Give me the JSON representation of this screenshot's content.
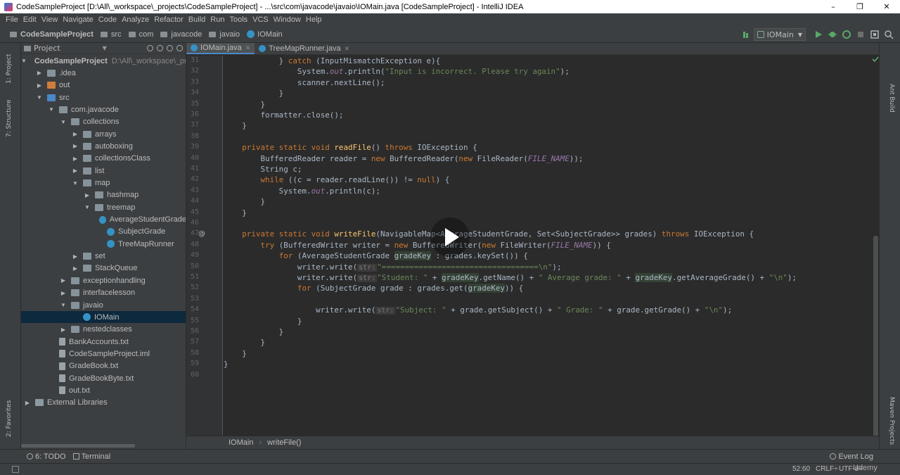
{
  "window": {
    "title": "CodeSampleProject [D:\\All\\_workspace\\_projects\\CodeSampleProject] - ...\\src\\com\\javacode\\javaio\\IOMain.java [CodeSampleProject] - IntelliJ IDEA",
    "controls": [
      "–",
      "❐",
      "✕"
    ]
  },
  "menu": [
    "File",
    "Edit",
    "View",
    "Navigate",
    "Code",
    "Analyze",
    "Refactor",
    "Build",
    "Run",
    "Tools",
    "VCS",
    "Window",
    "Help"
  ],
  "nav": {
    "crumbs": [
      "CodeSampleProject",
      "src",
      "com",
      "javacode",
      "javaio",
      "IOMain"
    ],
    "run_config": "IOMain"
  },
  "left_tabs": {
    "project": "1: Project",
    "structure": "7: Structure",
    "favorites": "2: Favorites"
  },
  "right_tabs": {
    "ant": "Ant Build",
    "maven": "Maven Projects"
  },
  "project_panel": {
    "header": "Project",
    "tree": [
      {
        "label": "CodeSampleProject",
        "hint": "D:\\All\\_workspace\\_proje",
        "arrow": "▼",
        "icon": "folder",
        "bold": true
      },
      {
        "label": ".idea",
        "arrow": "▶",
        "icon": "folder"
      },
      {
        "label": "out",
        "arrow": "▶",
        "icon": "out"
      },
      {
        "label": "src",
        "arrow": "▼",
        "icon": "src"
      },
      {
        "label": "com.javacode",
        "arrow": "▼",
        "icon": "folder"
      },
      {
        "label": "collections",
        "arrow": "▼",
        "icon": "folder"
      },
      {
        "label": "arrays",
        "arrow": "▶",
        "icon": "folder"
      },
      {
        "label": "autoboxing",
        "arrow": "▶",
        "icon": "folder"
      },
      {
        "label": "collectionsClass",
        "arrow": "▶",
        "icon": "folder"
      },
      {
        "label": "list",
        "arrow": "▶",
        "icon": "folder"
      },
      {
        "label": "map",
        "arrow": "▼",
        "icon": "folder"
      },
      {
        "label": "hashmap",
        "arrow": "▶",
        "icon": "folder"
      },
      {
        "label": "treemap",
        "arrow": "▼",
        "icon": "folder"
      },
      {
        "label": "AverageStudentGrade",
        "arrow": "",
        "icon": "class"
      },
      {
        "label": "SubjectGrade",
        "arrow": "",
        "icon": "class"
      },
      {
        "label": "TreeMapRunner",
        "arrow": "",
        "icon": "class"
      },
      {
        "label": "set",
        "arrow": "▶",
        "icon": "folder"
      },
      {
        "label": "StackQueue",
        "arrow": "▶",
        "icon": "folder"
      },
      {
        "label": "exceptionhandling",
        "arrow": "▶",
        "icon": "folder"
      },
      {
        "label": "interfacelesson",
        "arrow": "▶",
        "icon": "folder"
      },
      {
        "label": "javaio",
        "arrow": "▼",
        "icon": "folder"
      },
      {
        "label": "IOMain",
        "arrow": "",
        "icon": "class",
        "selected": true
      },
      {
        "label": "nestedclasses",
        "arrow": "▶",
        "icon": "folder"
      },
      {
        "label": "BankAccounts.txt",
        "arrow": "",
        "icon": "file"
      },
      {
        "label": "CodeSampleProject.iml",
        "arrow": "",
        "icon": "file"
      },
      {
        "label": "GradeBook.txt",
        "arrow": "",
        "icon": "file"
      },
      {
        "label": "GradeBookByte.txt",
        "arrow": "",
        "icon": "file"
      },
      {
        "label": "out.txt",
        "arrow": "",
        "icon": "file"
      },
      {
        "label": "External Libraries",
        "arrow": "▶",
        "icon": "library"
      }
    ]
  },
  "tabs": [
    {
      "label": "IOMain.java",
      "active": true
    },
    {
      "label": "TreeMapRunner.java",
      "active": false
    }
  ],
  "code": {
    "lines": [
      {
        "n": "31",
        "segs": [
          [
            "            } ",
            ""
          ],
          [
            "catch ",
            "kw"
          ],
          [
            "(InputMismatchException e){",
            ""
          ]
        ]
      },
      {
        "n": "32",
        "segs": [
          [
            "                System.",
            ""
          ],
          [
            "out",
            "cn"
          ],
          [
            ".println(",
            ""
          ],
          [
            "\"Input is incorrect. Please try again\"",
            "st"
          ],
          [
            ");",
            ""
          ]
        ]
      },
      {
        "n": "33",
        "segs": [
          [
            "                scanner.nextLine();",
            ""
          ]
        ]
      },
      {
        "n": "34",
        "segs": [
          [
            "            }",
            ""
          ]
        ]
      },
      {
        "n": "35",
        "segs": [
          [
            "        }",
            ""
          ]
        ]
      },
      {
        "n": "36",
        "segs": [
          [
            "        formatter.close();",
            ""
          ]
        ]
      },
      {
        "n": "37",
        "segs": [
          [
            "    }",
            ""
          ]
        ]
      },
      {
        "n": "38",
        "segs": [
          [
            "",
            ""
          ]
        ]
      },
      {
        "n": "39",
        "segs": [
          [
            "    ",
            ""
          ],
          [
            "private static void ",
            "kw"
          ],
          [
            "readFile",
            "fn"
          ],
          [
            "() ",
            ""
          ],
          [
            "throws ",
            "kw"
          ],
          [
            "IOException {",
            ""
          ]
        ]
      },
      {
        "n": "40",
        "segs": [
          [
            "        BufferedReader reader = ",
            ""
          ],
          [
            "new ",
            "kw"
          ],
          [
            "BufferedReader(",
            ""
          ],
          [
            "new ",
            "kw"
          ],
          [
            "FileReader(",
            ""
          ],
          [
            "FILE_NAME",
            "cn"
          ],
          [
            "));",
            ""
          ]
        ]
      },
      {
        "n": "41",
        "segs": [
          [
            "        String c;",
            ""
          ]
        ]
      },
      {
        "n": "42",
        "segs": [
          [
            "        ",
            ""
          ],
          [
            "while ",
            "kw"
          ],
          [
            "((c = reader.readLine()) != ",
            ""
          ],
          [
            "null",
            "kw"
          ],
          [
            ") {",
            ""
          ]
        ]
      },
      {
        "n": "43",
        "segs": [
          [
            "            System.",
            ""
          ],
          [
            "out",
            "cn"
          ],
          [
            ".println(c);",
            ""
          ]
        ]
      },
      {
        "n": "44",
        "segs": [
          [
            "        }",
            ""
          ]
        ]
      },
      {
        "n": "45",
        "segs": [
          [
            "    }",
            ""
          ]
        ]
      },
      {
        "n": "46",
        "segs": [
          [
            "",
            ""
          ]
        ]
      },
      {
        "n": "47",
        "segs": [
          [
            "    ",
            ""
          ],
          [
            "private static void ",
            "kw"
          ],
          [
            "writeFile",
            "fn"
          ],
          [
            "(NavigableMap<AverageStudentGrade, Set<SubjectGrade>> grades) ",
            ""
          ],
          [
            "throws ",
            "kw"
          ],
          [
            "IOException {",
            ""
          ]
        ]
      },
      {
        "n": "48",
        "segs": [
          [
            "        ",
            ""
          ],
          [
            "try ",
            "kw"
          ],
          [
            "(BufferedWriter writer = ",
            ""
          ],
          [
            "new ",
            "kw"
          ],
          [
            "BufferedWriter(",
            ""
          ],
          [
            "new ",
            "kw"
          ],
          [
            "FileWriter(",
            ""
          ],
          [
            "FILE_NAME",
            "cn"
          ],
          [
            ")) {",
            ""
          ]
        ]
      },
      {
        "n": "49",
        "segs": [
          [
            "            ",
            ""
          ],
          [
            "for ",
            "kw"
          ],
          [
            "(AverageStudentGrade ",
            ""
          ],
          [
            "gradeKey",
            "hl"
          ],
          [
            " : grades.keySet()) {",
            ""
          ]
        ]
      },
      {
        "n": "50",
        "segs": [
          [
            "                writer.write(",
            ""
          ],
          [
            "str:",
            "hint"
          ],
          [
            "\"==================================\\n\"",
            "st"
          ],
          [
            ");",
            ""
          ]
        ]
      },
      {
        "n": "51",
        "segs": [
          [
            "                writer.write(",
            ""
          ],
          [
            "str:",
            "hint"
          ],
          [
            "\"Student: \"",
            "st"
          ],
          [
            " + ",
            ""
          ],
          [
            "gradeKey",
            "hl"
          ],
          [
            ".getName() + ",
            ""
          ],
          [
            "\" Average grade: \"",
            "st"
          ],
          [
            " + ",
            ""
          ],
          [
            "gradeKey",
            "hl"
          ],
          [
            ".getAverageGrade() + ",
            ""
          ],
          [
            "\"\\n\"",
            "st"
          ],
          [
            ");",
            ""
          ]
        ]
      },
      {
        "n": "52",
        "segs": [
          [
            "                ",
            ""
          ],
          [
            "for ",
            "kw"
          ],
          [
            "(SubjectGrade grade : grades.get(",
            ""
          ],
          [
            "gradeKey",
            "hl"
          ],
          [
            ")) {",
            ""
          ]
        ]
      },
      {
        "n": "53",
        "segs": [
          [
            "",
            ""
          ]
        ]
      },
      {
        "n": "54",
        "segs": [
          [
            "                    writer.write(",
            ""
          ],
          [
            "str:",
            "hint"
          ],
          [
            "\"Subject: \"",
            "st"
          ],
          [
            " + grade.getSubject() + ",
            ""
          ],
          [
            "\" Grade: \"",
            "st"
          ],
          [
            " + grade.getGrade() + ",
            ""
          ],
          [
            "\"\\n\"",
            "st"
          ],
          [
            ");",
            ""
          ]
        ]
      },
      {
        "n": "55",
        "segs": [
          [
            "                }",
            ""
          ]
        ]
      },
      {
        "n": "56",
        "segs": [
          [
            "            }",
            ""
          ]
        ]
      },
      {
        "n": "57",
        "segs": [
          [
            "        }",
            ""
          ]
        ]
      },
      {
        "n": "58",
        "segs": [
          [
            "    }",
            ""
          ]
        ]
      },
      {
        "n": "59",
        "segs": [
          [
            "}",
            ""
          ]
        ]
      },
      {
        "n": "60",
        "segs": [
          [
            "",
            ""
          ]
        ]
      }
    ]
  },
  "editor_breadcrumb": [
    "IOMain",
    "writeFile()"
  ],
  "bottom_tools": {
    "todo": "6: TODO",
    "terminal": "Terminal",
    "event_log": "Event Log"
  },
  "status": {
    "position": "52:60",
    "line_sep": "CRLF÷",
    "encoding": "UTF-8÷",
    "watermark": "Udemy"
  }
}
